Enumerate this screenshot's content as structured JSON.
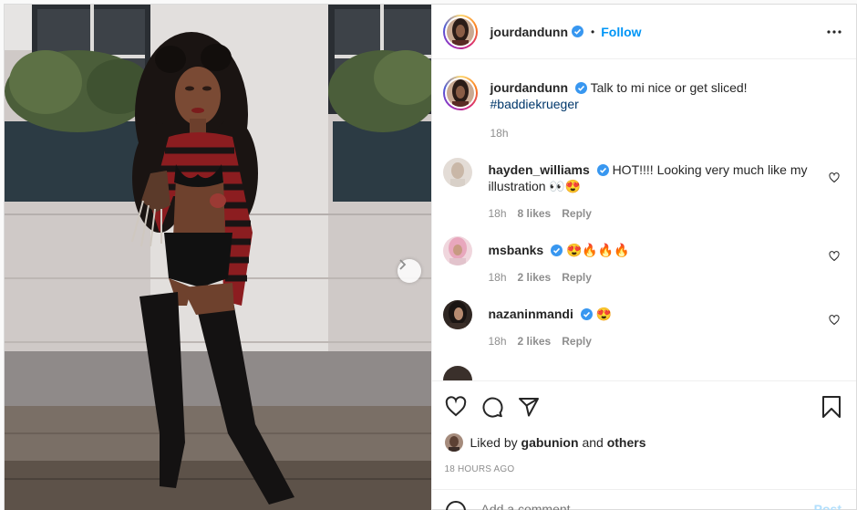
{
  "post": {
    "author": "jourdandunn",
    "verified": true,
    "separator": "•",
    "follow_label": "Follow",
    "more_icon": "more-horizontal-icon"
  },
  "caption": {
    "username": "jourdandunn",
    "text": "Talk to mi nice or get sliced!",
    "hashtag": "#baddiekrueger",
    "time": "18h"
  },
  "comments": [
    {
      "username": "hayden_williams",
      "text": "HOT!!!! Looking very much like my illustration 👀😍",
      "time": "18h",
      "likes": "8 likes",
      "reply": "Reply"
    },
    {
      "username": "msbanks",
      "text": "😍🔥🔥🔥",
      "time": "18h",
      "likes": "2 likes",
      "reply": "Reply"
    },
    {
      "username": "nazaninmandi",
      "text": "😍",
      "time": "18h",
      "likes": "2 likes",
      "reply": "Reply"
    }
  ],
  "likes": {
    "prefix": "Liked by",
    "user": "gabunion",
    "joiner": "and",
    "others": "others"
  },
  "timestamp": "18 HOURS AGO",
  "add_comment": {
    "placeholder": "Add a comment…",
    "post_label": "Post"
  },
  "colors": {
    "accent": "#0095f6",
    "hashtag": "#00376b",
    "muted": "#8e8e8e",
    "verified": "#3897f0"
  }
}
